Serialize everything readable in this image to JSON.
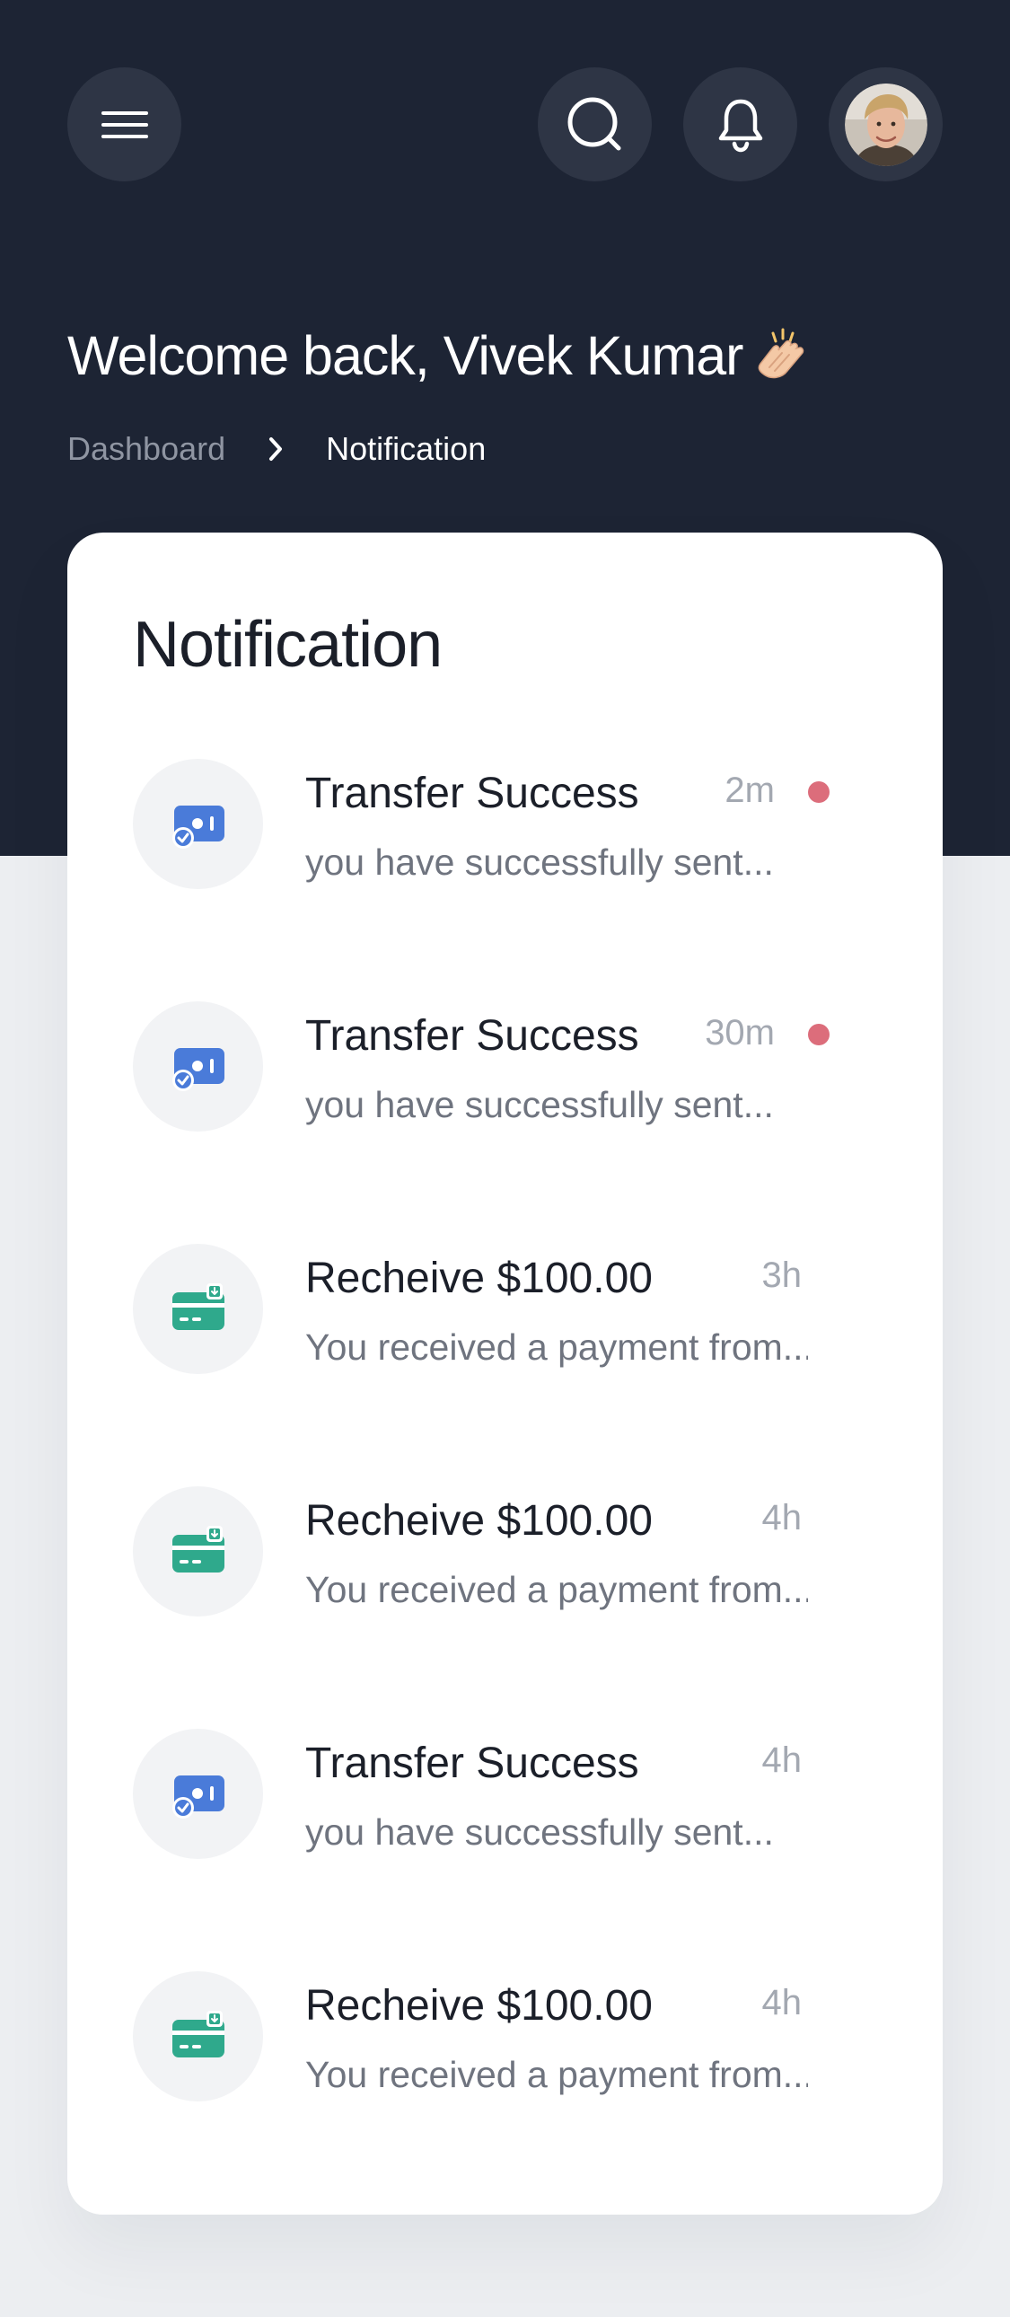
{
  "header": {
    "welcome": "Welcome back, Vivek Kumar",
    "breadcrumb": {
      "parent": "Dashboard",
      "current": "Notification"
    }
  },
  "card": {
    "title": "Notification",
    "notifications": [
      {
        "type": "transfer",
        "title": "Transfer Success",
        "desc": "you have successfully sent...",
        "time": "2m",
        "unread": true
      },
      {
        "type": "transfer",
        "title": "Transfer Success",
        "desc": "you have successfully sent...",
        "time": "30m",
        "unread": true
      },
      {
        "type": "receive",
        "title": "Recheive $100.00",
        "desc": "You received a payment from...",
        "time": "3h",
        "unread": false
      },
      {
        "type": "receive",
        "title": "Recheive $100.00",
        "desc": "You received a payment from...",
        "time": "4h",
        "unread": false
      },
      {
        "type": "transfer",
        "title": "Transfer Success",
        "desc": "you have successfully sent...",
        "time": "4h",
        "unread": false
      },
      {
        "type": "receive",
        "title": "Recheive $100.00",
        "desc": "You received a payment from...",
        "time": "4h",
        "unread": false
      }
    ]
  },
  "colors": {
    "header_bg": "#1d2434",
    "button_bg": "#2e3545",
    "transfer_icon": "#4a7bd9",
    "receive_icon": "#2fa98c",
    "unread_dot": "#dc6d7b"
  },
  "icons": {
    "menu": "hamburger-icon",
    "search": "search-icon",
    "notifications": "bell-icon",
    "transfer": "card-check-icon",
    "receive": "card-download-icon",
    "greeting": "clapping-hands-emoji"
  }
}
